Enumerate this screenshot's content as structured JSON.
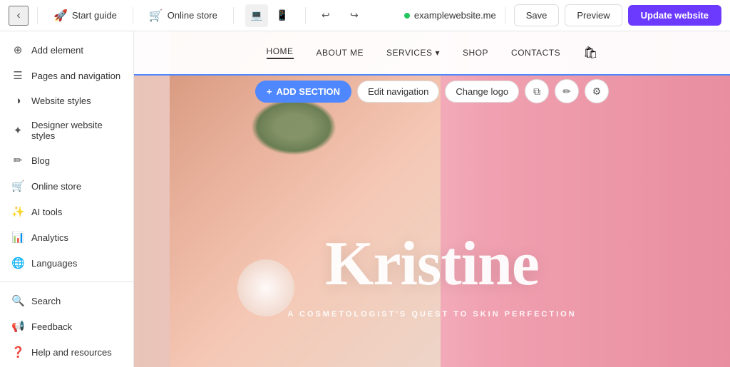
{
  "topbar": {
    "back_icon": "‹",
    "start_guide_label": "Start guide",
    "start_guide_icon": "🚀",
    "online_store_label": "Online store",
    "online_store_icon": "🛒",
    "device_desktop_icon": "💻",
    "device_mobile_icon": "📱",
    "undo_icon": "↩",
    "redo_icon": "↪",
    "url_dot_color": "#22c55e",
    "url_text": "examplewebsite.me",
    "save_label": "Save",
    "preview_label": "Preview",
    "update_label": "Update website"
  },
  "sidebar": {
    "items_top": [
      {
        "id": "add-element",
        "icon": "⊕",
        "label": "Add element"
      },
      {
        "id": "pages-navigation",
        "icon": "☰",
        "label": "Pages and navigation"
      },
      {
        "id": "website-styles",
        "icon": "◑",
        "label": "Website styles"
      },
      {
        "id": "designer-styles",
        "icon": "✦",
        "label": "Designer website styles"
      },
      {
        "id": "blog",
        "icon": "✏",
        "label": "Blog"
      },
      {
        "id": "online-store",
        "icon": "🛒",
        "label": "Online store"
      },
      {
        "id": "ai-tools",
        "icon": "✨",
        "label": "AI tools"
      },
      {
        "id": "analytics",
        "icon": "📊",
        "label": "Analytics"
      },
      {
        "id": "languages",
        "icon": "🌐",
        "label": "Languages"
      }
    ],
    "items_bottom": [
      {
        "id": "search",
        "icon": "🔍",
        "label": "Search"
      },
      {
        "id": "feedback",
        "icon": "📢",
        "label": "Feedback"
      },
      {
        "id": "help",
        "icon": "❓",
        "label": "Help and resources"
      }
    ]
  },
  "preview": {
    "nav_items": [
      {
        "id": "home",
        "label": "HOME",
        "active": true
      },
      {
        "id": "about",
        "label": "ABOUT ME",
        "active": false
      },
      {
        "id": "services",
        "label": "SERVICES",
        "active": false,
        "dropdown": true
      },
      {
        "id": "shop",
        "label": "SHOP",
        "active": false
      },
      {
        "id": "contacts",
        "label": "CONTACTS",
        "active": false
      }
    ],
    "cart_icon": "🛍",
    "toolbar": {
      "add_section_icon": "+",
      "add_section_label": "ADD SECTION",
      "edit_nav_label": "Edit navigation",
      "change_logo_label": "Change logo",
      "copy_icon": "⧉",
      "edit_icon": "✏",
      "settings_icon": "⚙"
    },
    "hero_title": "Kristine",
    "hero_subtitle": "A COSMETOLOGIST'S QUEST TO SKIN PERFECTION"
  }
}
